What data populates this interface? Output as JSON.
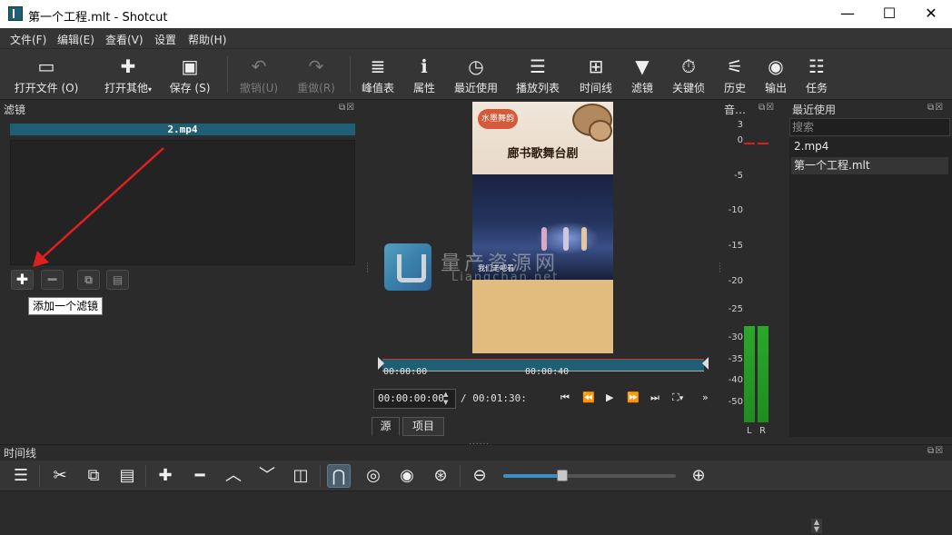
{
  "window": {
    "title": "第一个工程.mlt - Shotcut",
    "minimize_glyph": "—",
    "maximize_glyph": "☐",
    "close_glyph": "✕"
  },
  "menu": [
    "文件(F)",
    "编辑(E)",
    "查看(V)",
    "设置",
    "帮助(H)"
  ],
  "toolbar": {
    "open_file": "打开文件 (O)",
    "open_other": "打开其他",
    "save": "保存 (S)",
    "undo": "撤销(U)",
    "redo": "重做(R)",
    "peak_meter": "峰值表",
    "properties": "属性",
    "recent": "最近使用",
    "playlist": "播放列表",
    "timeline": "时间线",
    "filters": "滤镜",
    "keyframes": "关键侦",
    "history": "历史",
    "export": "输出",
    "jobs": "任务"
  },
  "filters_panel": {
    "title": "滤镜",
    "clip_name": "2.mp4",
    "tooltip": "添加一个滤镜"
  },
  "player": {
    "video_title": "廊书歌舞台剧",
    "video_logo": "水墨舞韵",
    "video_subtitle": "我们走吧看",
    "scrub_label_start": "00:00:00",
    "scrub_label_mid": "00:00:40",
    "timecode": "00:00:00:00",
    "duration": "/ 00:01:30:",
    "tab_source": "源",
    "tab_project": "项目"
  },
  "watermark": {
    "cn": "量产资源网",
    "en": "Liangchan.net"
  },
  "audio_meter": {
    "title": "音…",
    "db_labels": [
      "3",
      "0",
      "-5",
      "-10",
      "-15",
      "-20",
      "-25",
      "-30",
      "-35",
      "-40",
      "-50"
    ],
    "left_label": "L",
    "right_label": "R",
    "colors": {
      "level": "#2aa82a",
      "peak": "#d42020"
    }
  },
  "recent_panel": {
    "title": "最近使用",
    "search_placeholder": "搜索",
    "items": [
      "2.mp4",
      "第一个工程.mlt"
    ]
  },
  "timeline": {
    "title": "时间线",
    "zoom_level": 0.34
  },
  "colors": {
    "accent": "#1e5f74",
    "background": "#2b2b2b",
    "toolbar": "#353535",
    "arrow": "#e02020"
  }
}
